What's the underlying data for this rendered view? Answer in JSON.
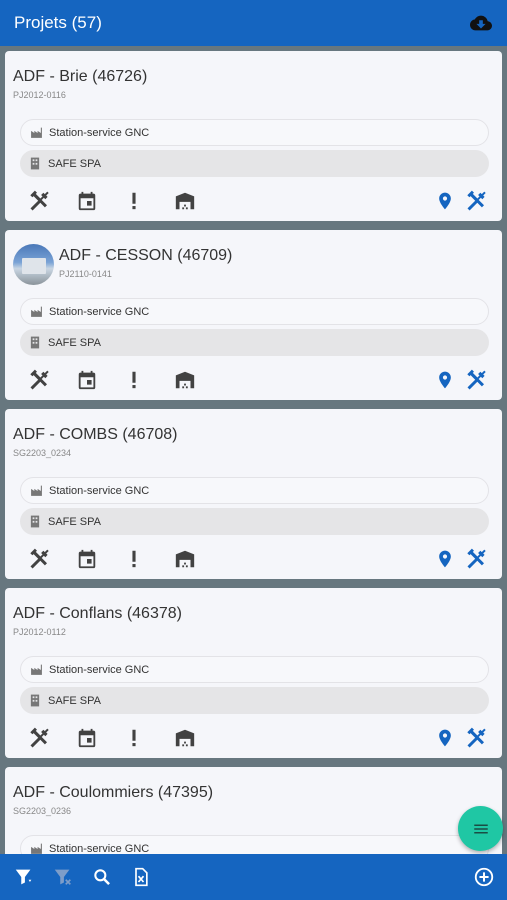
{
  "appbar": {
    "title": "Projets (57)",
    "cloud_icon": "cloud-download-icon"
  },
  "projects": [
    {
      "name": "ADF - Brie (46726)",
      "code": "PJ2012-0116",
      "type": "Station-service GNC",
      "company": "SAFE SPA",
      "has_avatar": false
    },
    {
      "name": "ADF - CESSON (46709)",
      "code": "PJ2110-0141",
      "type": "Station-service GNC",
      "company": "SAFE SPA",
      "has_avatar": true
    },
    {
      "name": "ADF - COMBS (46708)",
      "code": "SG2203_0234",
      "type": "Station-service GNC",
      "company": "SAFE SPA",
      "has_avatar": false
    },
    {
      "name": "ADF - Conflans (46378)",
      "code": "PJ2012-0112",
      "type": "Station-service GNC",
      "company": "SAFE SPA",
      "has_avatar": false
    },
    {
      "name": "ADF - Coulommiers (47395)",
      "code": "SG2203_0236",
      "type": "Station-service GNC",
      "company": "",
      "has_avatar": false
    }
  ],
  "colors": {
    "primary": "#1565c0",
    "fab": "#1fc7a4",
    "icon_dark": "#424242",
    "icon_blue": "#1565c0"
  },
  "bottombar": {
    "icons": [
      "filter-icon",
      "clear-filter-icon",
      "search-icon",
      "excel-export-icon",
      "add-circle-icon"
    ]
  }
}
